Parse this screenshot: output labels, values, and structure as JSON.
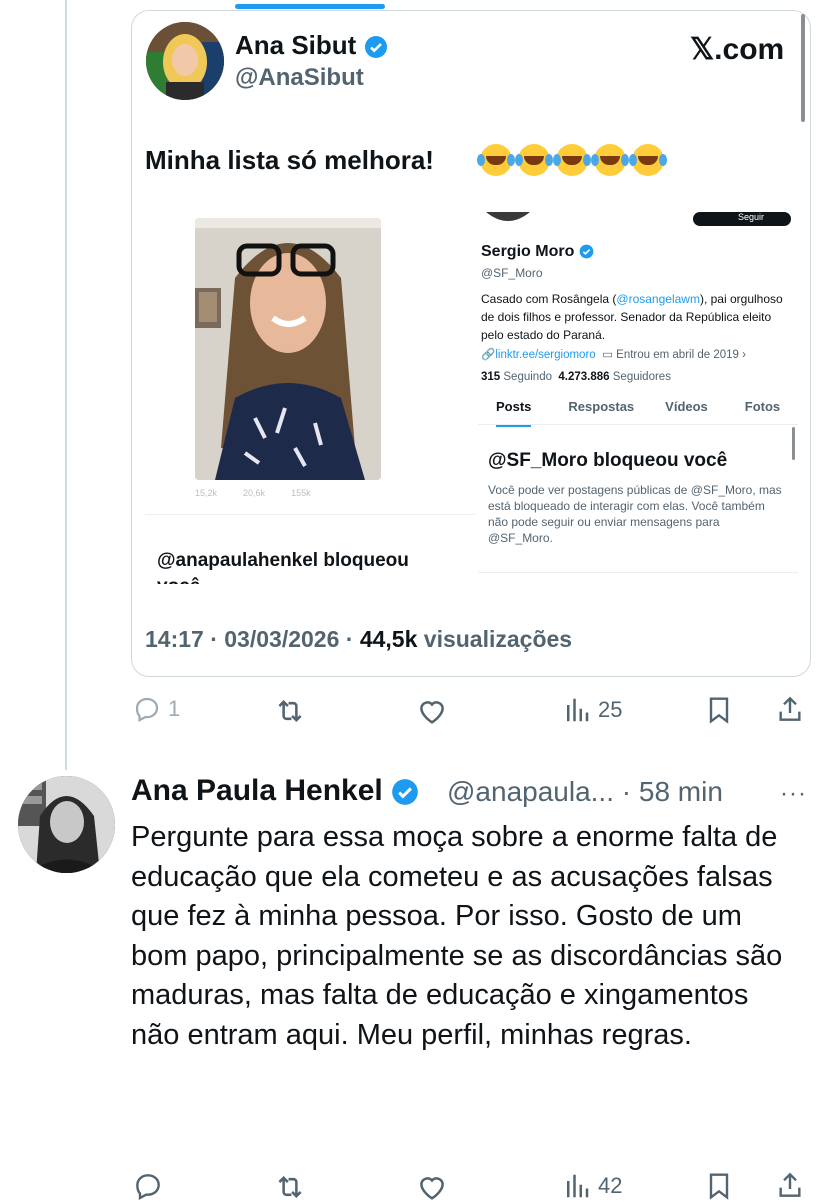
{
  "quoted": {
    "author_name": "Ana Sibut",
    "author_handle": "@AnaSibut",
    "site": "𝕏.com",
    "text": "Minha lista só melhora!",
    "timestamp": "14:17 · 03/03/2026 · ",
    "views_count": "44,5k",
    "views_label": " visualizações",
    "embedded": {
      "faded_stats": [
        "15,2k",
        "20,6k",
        "155k"
      ],
      "left_blocked": "@anapaulahenkel bloqueou você",
      "follow_button": "Seguir",
      "profile_name": "Sergio Moro",
      "profile_handle": "@SF_Moro",
      "bio_before": "Casado com Rosângela (",
      "bio_link": "@rosangelawm",
      "bio_after": "), pai orgulhoso de dois filhos e professor. Senador da República eleito pelo estado do Paraná.",
      "link": "linktr.ee/sergiomoro",
      "joined": "Entrou em abril de 2019",
      "following_count": "315",
      "following_label": "Seguindo",
      "followers_count": "4.273.886",
      "followers_label": "Seguidores",
      "tabs": [
        "Posts",
        "Respostas",
        "Vídeos",
        "Fotos"
      ],
      "blocked_title": "@SF_Moro bloqueou você",
      "blocked_text": "Você pode ver postagens públicas de @SF_Moro, mas está bloqueado de interagir com elas. Você também não pode seguir ou enviar mensagens para @SF_Moro."
    }
  },
  "actions1": {
    "replies": "1",
    "retweets": "",
    "likes": "",
    "views": "25"
  },
  "reply": {
    "author_name": "Ana Paula Henkel",
    "author_handle": "@anapaula... · 58 min",
    "more": "···",
    "text": "Pergunte para essa moça sobre a enorme falta de educação que ela cometeu e as acusações falsas que fez à minha pessoa. Por isso. Gosto de um bom papo, principalmente se as discordâncias são maduras, mas falta de educação e xingamentos não entram aqui. Meu perfil, minhas regras."
  },
  "actions2": {
    "views": "42"
  },
  "colors": {
    "accent": "#1d9bf0",
    "text": "#0f1419",
    "muted": "#536471"
  }
}
